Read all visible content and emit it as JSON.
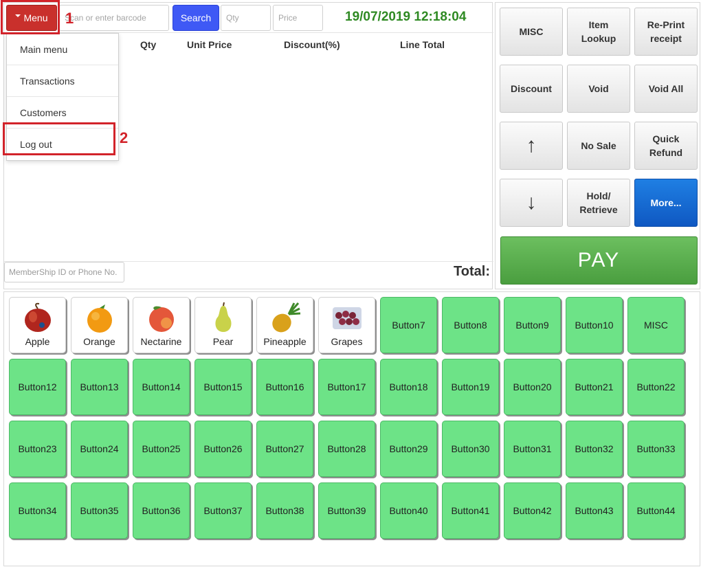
{
  "header": {
    "menu_label": "Menu",
    "barcode_placeholder": "Scan or enter barcode",
    "search_label": "Search",
    "qty_placeholder": "Qty",
    "price_placeholder": "Price",
    "datetime": "19/07/2019 12:18:04"
  },
  "columns": [
    "Qty",
    "Unit Price",
    "Discount(%)",
    "Line Total"
  ],
  "menu_dropdown": {
    "items": [
      "Main menu",
      "Transactions",
      "Customers",
      "Log out"
    ]
  },
  "annotations": {
    "callout_1": "1",
    "callout_2": "2"
  },
  "footer": {
    "membership_placeholder": "MemberShip ID or Phone No.",
    "total_label": "Total:"
  },
  "functions": {
    "buttons": [
      "MISC",
      "Item Lookup",
      "Re-Print receipt",
      "Discount",
      "Void",
      "Void All",
      "↑",
      "No Sale",
      "Quick Refund",
      "↓",
      "Hold/ Retrieve",
      "More..."
    ],
    "pay_label": "PAY"
  },
  "products": {
    "fruits": [
      {
        "label": "Apple",
        "icon": "apple-icon"
      },
      {
        "label": "Orange",
        "icon": "orange-icon"
      },
      {
        "label": "Nectarine",
        "icon": "nectarine-icon"
      },
      {
        "label": "Pear",
        "icon": "pear-icon"
      },
      {
        "label": "Pineapple",
        "icon": "pineapple-icon"
      },
      {
        "label": "Grapes",
        "icon": "grapes-icon"
      }
    ],
    "buttons": [
      "Button7",
      "Button8",
      "Button9",
      "Button10",
      "MISC",
      "Button12",
      "Button13",
      "Button14",
      "Button15",
      "Button16",
      "Button17",
      "Button18",
      "Button19",
      "Button20",
      "Button21",
      "Button22",
      "Button23",
      "Button24",
      "Button25",
      "Button26",
      "Button27",
      "Button28",
      "Button29",
      "Button30",
      "Button31",
      "Button32",
      "Button33",
      "Button34",
      "Button35",
      "Button36",
      "Button37",
      "Button38",
      "Button39",
      "Button40",
      "Button41",
      "Button42",
      "Button43",
      "Button44"
    ]
  },
  "colors": {
    "menu_red": "#c9302c",
    "search_blue": "#3f59f5",
    "datetime_green": "#2f8a23",
    "tile_green": "#6de387",
    "pay_green": "#5cb04f",
    "more_blue": "#1f7fe3",
    "annotation_red": "#d2232a"
  }
}
